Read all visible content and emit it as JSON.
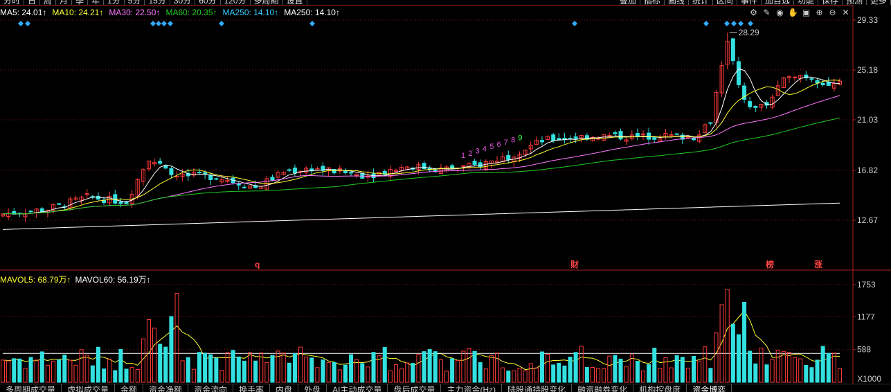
{
  "top_tabs_left": [
    "分时",
    "日",
    "周",
    "月",
    "季",
    "年",
    "1分",
    "5分",
    "15分",
    "30分",
    "60分",
    "120分",
    "多周期",
    "设置"
  ],
  "top_tabs_right": [
    "叠加",
    "指标",
    "画线",
    "统计",
    "区间",
    "事件",
    "加自选",
    "功能",
    "保存",
    "预测",
    "更多"
  ],
  "ma_legend": [
    {
      "text": "MA5: 24.01↑",
      "color": "#ffffff"
    },
    {
      "text": "MA10: 24.21↑",
      "color": "#ffff33"
    },
    {
      "text": "MA30: 22.50↑",
      "color": "#ff77ff"
    },
    {
      "text": "MA60: 20.35↑",
      "color": "#22cc22"
    },
    {
      "text": "MA250: 14.10↑",
      "color": "#33ccff"
    },
    {
      "text": "MA250: 14.10↑",
      "color": "#ffffff"
    }
  ],
  "vol_legend": [
    {
      "text": "MAVOL5: 68.79万↑",
      "color": "#ffff33"
    },
    {
      "text": "MAVOL60: 56.19万↑",
      "color": "#ffffff"
    }
  ],
  "price_axis": [
    "29.33",
    "25.18",
    "21.03",
    "16.82",
    "12.67"
  ],
  "volume_axis": [
    "1753",
    "1177",
    "588"
  ],
  "volume_unit": "X1000",
  "high_label": "28.29",
  "event_markers": [
    "q",
    "财",
    "榜",
    "涨"
  ],
  "nine_count": [
    "1",
    "2",
    "3",
    "4",
    "5",
    "6",
    "7",
    "8",
    "9"
  ],
  "bottom_tabs": [
    {
      "label": "多周期成交量",
      "active": false
    },
    {
      "label": "虚拟成交量",
      "active": false
    },
    {
      "label": "金额",
      "active": false
    },
    {
      "label": "资金净额",
      "active": false
    },
    {
      "label": "资金流向",
      "active": false
    },
    {
      "label": "换手率",
      "active": false
    },
    {
      "label": "内盘",
      "active": false
    },
    {
      "label": "外盘",
      "active": false
    },
    {
      "label": "AI主动成交量",
      "active": false
    },
    {
      "label": "盘后成交量",
      "active": false
    },
    {
      "label": "主力资金(Hz)",
      "active": false
    },
    {
      "label": "陆股通持股变化",
      "active": false
    },
    {
      "label": "融资融券变化",
      "active": false
    },
    {
      "label": "机构控盘度",
      "active": false
    },
    {
      "label": "资金博弈",
      "active": true
    }
  ],
  "toolbar_icons": [
    "gear-icon",
    "pen-icon",
    "eye-icon",
    "hand-icon",
    "bag-icon",
    "zoom-in-icon",
    "zoom-out-icon",
    "close-icon"
  ],
  "colors": {
    "up": "#ff3b3b",
    "down": "#33e0e0",
    "grid": "#7a1818",
    "axis": "#aa2222"
  },
  "chart_data": [
    {
      "type": "candlestick",
      "title": "",
      "y_ticks": [
        29.33,
        25.18,
        21.03,
        16.82,
        12.67
      ],
      "ylim": [
        10.8,
        30.5
      ],
      "ma_series_names": [
        "MA5",
        "MA10",
        "MA30",
        "MA60",
        "MA250"
      ],
      "annotations": [
        "28.29",
        "q",
        "财",
        "榜",
        "涨"
      ]
    },
    {
      "type": "bar",
      "title": "",
      "series_names": [
        "MAVOL5",
        "MAVOL60"
      ],
      "y_ticks": [
        1753,
        1177,
        588
      ],
      "unit": "X1000"
    }
  ]
}
